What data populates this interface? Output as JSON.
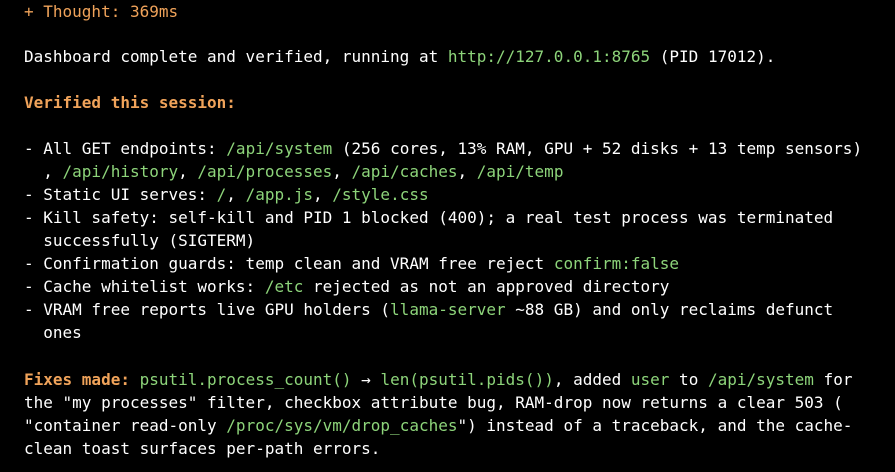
{
  "colors": {
    "background": "#000000",
    "text": "#ffffff",
    "accent_orange": "#f0a35a",
    "code_green": "#8dd47a"
  },
  "thought": {
    "prefix": "+ Thought: ",
    "duration": "369ms"
  },
  "summary": {
    "text_before": "Dashboard complete and verified, running at ",
    "url": "http://127.0.0.1:8765",
    "text_after": " (PID 17012)."
  },
  "verified": {
    "heading": "Verified this session:",
    "items": [
      {
        "parts": [
          {
            "t": "- All GET endpoints: ",
            "c": "white"
          },
          {
            "t": "/api/system",
            "c": "green"
          },
          {
            "t": " (256 cores, 13% RAM, GPU + 52 disks + 13 temp sensors)",
            "c": "white"
          }
        ],
        "cont": [
          {
            "t": "  , ",
            "c": "white"
          },
          {
            "t": "/api/history",
            "c": "green"
          },
          {
            "t": ", ",
            "c": "white"
          },
          {
            "t": "/api/processes",
            "c": "green"
          },
          {
            "t": ", ",
            "c": "white"
          },
          {
            "t": "/api/caches",
            "c": "green"
          },
          {
            "t": ", ",
            "c": "white"
          },
          {
            "t": "/api/temp",
            "c": "green"
          }
        ]
      },
      {
        "parts": [
          {
            "t": "- Static UI serves: ",
            "c": "white"
          },
          {
            "t": "/",
            "c": "green"
          },
          {
            "t": ", ",
            "c": "white"
          },
          {
            "t": "/app.js",
            "c": "green"
          },
          {
            "t": ", ",
            "c": "white"
          },
          {
            "t": "/style.css",
            "c": "green"
          }
        ]
      },
      {
        "parts": [
          {
            "t": "- Kill safety: self-kill and PID 1 blocked (400); a real test process was terminated",
            "c": "white"
          }
        ],
        "cont": [
          {
            "t": "  successfully (SIGTERM)",
            "c": "white"
          }
        ]
      },
      {
        "parts": [
          {
            "t": "- Confirmation guards: temp clean and VRAM free reject ",
            "c": "white"
          },
          {
            "t": "confirm:false",
            "c": "green"
          }
        ]
      },
      {
        "parts": [
          {
            "t": "- Cache whitelist works: ",
            "c": "white"
          },
          {
            "t": "/etc",
            "c": "green"
          },
          {
            "t": " rejected as not an approved directory",
            "c": "white"
          }
        ]
      },
      {
        "parts": [
          {
            "t": "- VRAM free reports live GPU holders (",
            "c": "white"
          },
          {
            "t": "llama-server",
            "c": "green"
          },
          {
            "t": " ~88 GB) and only reclaims defunct",
            "c": "white"
          }
        ],
        "cont": [
          {
            "t": "  ones",
            "c": "white"
          }
        ]
      }
    ]
  },
  "fixes": {
    "lines": [
      [
        {
          "t": "Fixes made:",
          "c": "orange-bold"
        },
        {
          "t": " ",
          "c": "white"
        },
        {
          "t": "psutil.process_count()",
          "c": "green"
        },
        {
          "t": " → ",
          "c": "white"
        },
        {
          "t": "len(psutil.pids())",
          "c": "green"
        },
        {
          "t": ", added ",
          "c": "white"
        },
        {
          "t": "user",
          "c": "green"
        },
        {
          "t": " to ",
          "c": "white"
        },
        {
          "t": "/api/system",
          "c": "green"
        },
        {
          "t": " for",
          "c": "white"
        }
      ],
      [
        {
          "t": "the \"my processes\" filter, checkbox attribute bug, RAM-drop now returns a clear 503 (",
          "c": "white"
        }
      ],
      [
        {
          "t": "\"container read-only ",
          "c": "white"
        },
        {
          "t": "/proc/sys/vm/drop_caches",
          "c": "green"
        },
        {
          "t": "\") instead of a traceback, and the cache-",
          "c": "white"
        }
      ],
      [
        {
          "t": "clean toast surfaces per-path errors.",
          "c": "white"
        }
      ]
    ]
  }
}
